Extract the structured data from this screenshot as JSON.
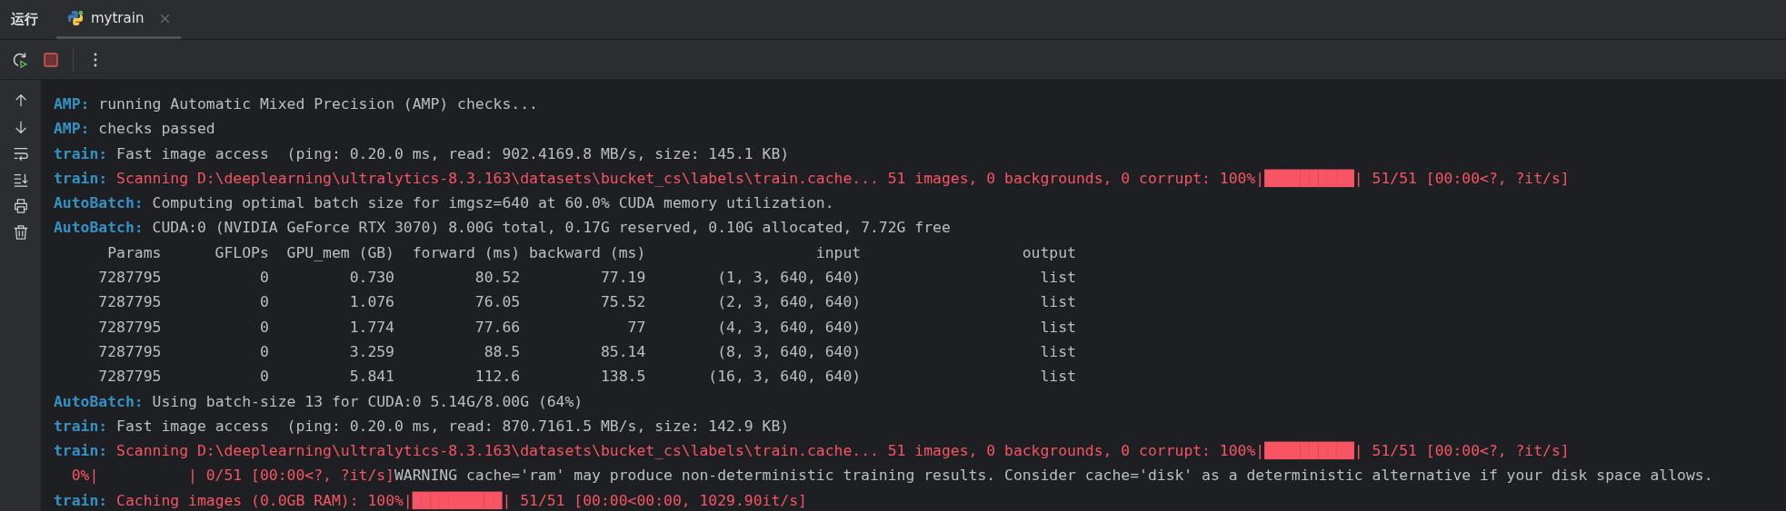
{
  "tool_window": {
    "title": "运行",
    "tabs": [
      {
        "label": "mytrain",
        "selected": true
      }
    ]
  },
  "console": {
    "lines": [
      {
        "segments": [
          {
            "kind": "prefix",
            "text": "AMP:"
          },
          {
            "kind": "text",
            "text": " running Automatic Mixed Precision (AMP) checks..."
          }
        ]
      },
      {
        "segments": [
          {
            "kind": "prefix",
            "text": "AMP:"
          },
          {
            "kind": "text",
            "text": " checks passed"
          }
        ]
      },
      {
        "segments": [
          {
            "kind": "prefix",
            "text": "train:"
          },
          {
            "kind": "text",
            "text": " Fast image access  (ping: 0.20.0 ms, read: 902.4169.8 MB/s, size: 145.1 KB)"
          }
        ]
      },
      {
        "segments": [
          {
            "kind": "prefix",
            "text": "train:"
          },
          {
            "kind": "error",
            "text": " Scanning D:\\deeplearning\\ultralytics-8.3.163\\datasets\\bucket_cs\\labels\\train.cache... 51 images, 0 backgrounds, 0 corrupt: 100%|██████████| 51/51 [00:00<?, ?it/s]"
          }
        ]
      },
      {
        "segments": [
          {
            "kind": "prefix",
            "text": "AutoBatch:"
          },
          {
            "kind": "text",
            "text": " Computing optimal batch size for imgsz=640 at 60.0% CUDA memory utilization."
          }
        ]
      },
      {
        "segments": [
          {
            "kind": "prefix",
            "text": "AutoBatch:"
          },
          {
            "kind": "text",
            "text": " CUDA:0 (NVIDIA GeForce RTX 3070) 8.00G total, 0.17G reserved, 0.10G allocated, 7.72G free"
          }
        ]
      },
      {
        "segments": [
          {
            "kind": "text",
            "text": "      Params      GFLOPs  GPU_mem (GB)  forward (ms) backward (ms)                   input                  output"
          }
        ]
      },
      {
        "segments": [
          {
            "kind": "text",
            "text": "     7287795           0         0.730         80.52         77.19        (1, 3, 640, 640)                    list"
          }
        ]
      },
      {
        "segments": [
          {
            "kind": "text",
            "text": "     7287795           0         1.076         76.05         75.52        (2, 3, 640, 640)                    list"
          }
        ]
      },
      {
        "segments": [
          {
            "kind": "text",
            "text": "     7287795           0         1.774         77.66            77        (4, 3, 640, 640)                    list"
          }
        ]
      },
      {
        "segments": [
          {
            "kind": "text",
            "text": "     7287795           0         3.259          88.5         85.14        (8, 3, 640, 640)                    list"
          }
        ]
      },
      {
        "segments": [
          {
            "kind": "text",
            "text": "     7287795           0         5.841         112.6         138.5       (16, 3, 640, 640)                    list"
          }
        ]
      },
      {
        "segments": [
          {
            "kind": "prefix",
            "text": "AutoBatch:"
          },
          {
            "kind": "text",
            "text": " Using batch-size 13 for CUDA:0 5.14G/8.00G (64%)"
          }
        ]
      },
      {
        "segments": [
          {
            "kind": "prefix",
            "text": "train:"
          },
          {
            "kind": "text",
            "text": " Fast image access  (ping: 0.20.0 ms, read: 870.7161.5 MB/s, size: 142.9 KB)"
          }
        ]
      },
      {
        "segments": [
          {
            "kind": "prefix",
            "text": "train:"
          },
          {
            "kind": "error",
            "text": " Scanning D:\\deeplearning\\ultralytics-8.3.163\\datasets\\bucket_cs\\labels\\train.cache... 51 images, 0 backgrounds, 0 corrupt: 100%|██████████| 51/51 [00:00<?, ?it/s]"
          }
        ]
      },
      {
        "segments": [
          {
            "kind": "error",
            "text": "  0%|          | 0/51 [00:00<?, ?it/s]"
          },
          {
            "kind": "text",
            "text": "WARNING cache='ram' may produce non-deterministic training results. Consider cache='disk' as a deterministic alternative if your disk space allows."
          }
        ]
      },
      {
        "segments": [
          {
            "kind": "prefix",
            "text": "train:"
          },
          {
            "kind": "error",
            "text": " Caching images (0.0GB RAM): 100%|██████████| 51/51 [00:00<00:00, 1029.90it/s]"
          }
        ]
      }
    ]
  }
}
